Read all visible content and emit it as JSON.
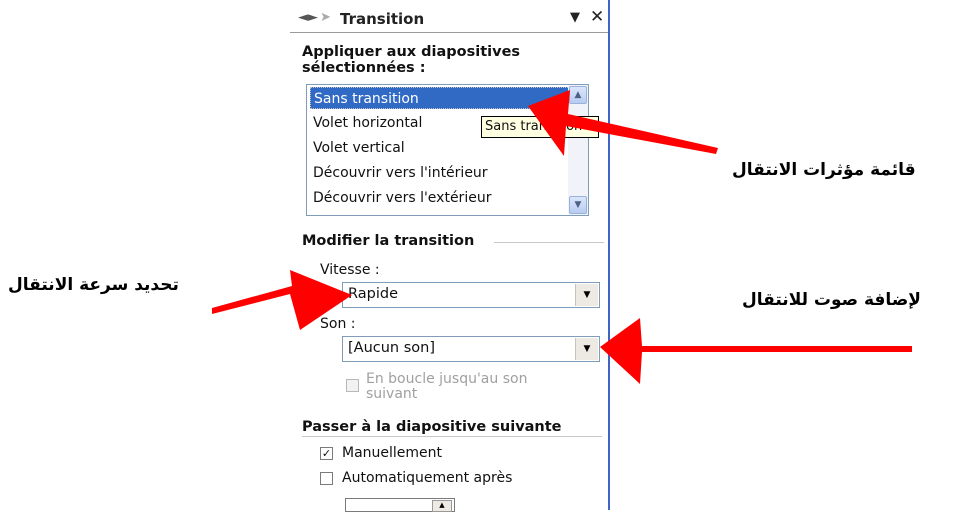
{
  "pane": {
    "title": "Transition",
    "back_icon": "back-arrow-icon",
    "forward_icon": "forward-arrow-icon",
    "menu_icon": "dropdown-arrow-icon",
    "close_icon": "close-icon",
    "apply_heading_line1": "Appliquer aux diapositives",
    "apply_heading_line2": "sélectionnées :",
    "transitions": [
      "Sans transition",
      "Volet horizontal",
      "Volet vertical",
      "Découvrir vers l'intérieur",
      "Découvrir vers l'extérieur"
    ],
    "selected_transition": "Sans transition",
    "tooltip": "Sans transition",
    "modify_heading": "Modifier la transition",
    "speed_label": "Vitesse :",
    "speed_value": "Rapide",
    "sound_label": "Son :",
    "sound_value": "[Aucun son]",
    "loop_label": "En boucle jusqu'au son suivant",
    "loop_checked": false,
    "advance_heading": "Passer à la diapositive suivante",
    "manual_label": "Manuellement",
    "manual_checked": true,
    "auto_label": "Automatiquement après",
    "auto_checked": false
  },
  "annotations": {
    "transitions_list": "قائمة مؤثرات الانتقال",
    "speed": "تحديد سرعة الانتقال",
    "sound": "لإضافة صوت للانتقال"
  },
  "colors": {
    "selection": "#316ac5",
    "arrow": "#ff0000",
    "pane_border": "#3f64c6",
    "tooltip_bg": "#ffffe1"
  }
}
